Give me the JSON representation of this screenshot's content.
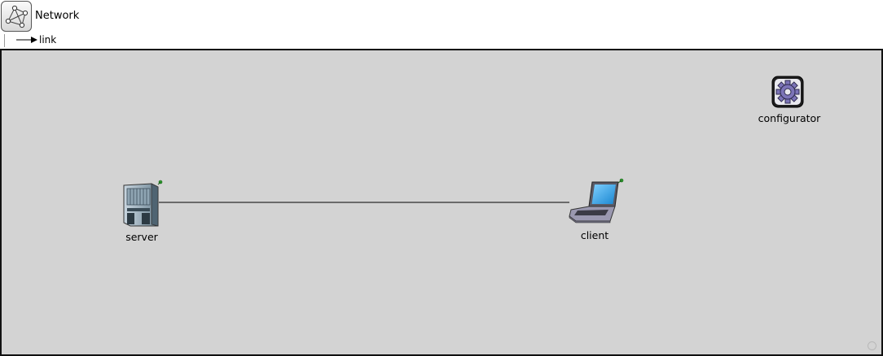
{
  "network": {
    "title": "Network",
    "icon": "network-icon"
  },
  "legend": {
    "link_label": "link"
  },
  "modules": {
    "server": {
      "label": "server",
      "icon": "server-icon"
    },
    "client": {
      "label": "client",
      "icon": "laptop-icon"
    },
    "configurator": {
      "label": "configurator",
      "icon": "gear-icon"
    }
  },
  "connections": [
    {
      "from": "server",
      "to": "client",
      "type": "link"
    }
  ],
  "colors": {
    "canvas_background": "#d3d3d3",
    "canvas_border": "#111111",
    "status_pin": "#2e9e2e",
    "laptop_screen": "#2aa6e6",
    "gear": "#7c74b8"
  }
}
